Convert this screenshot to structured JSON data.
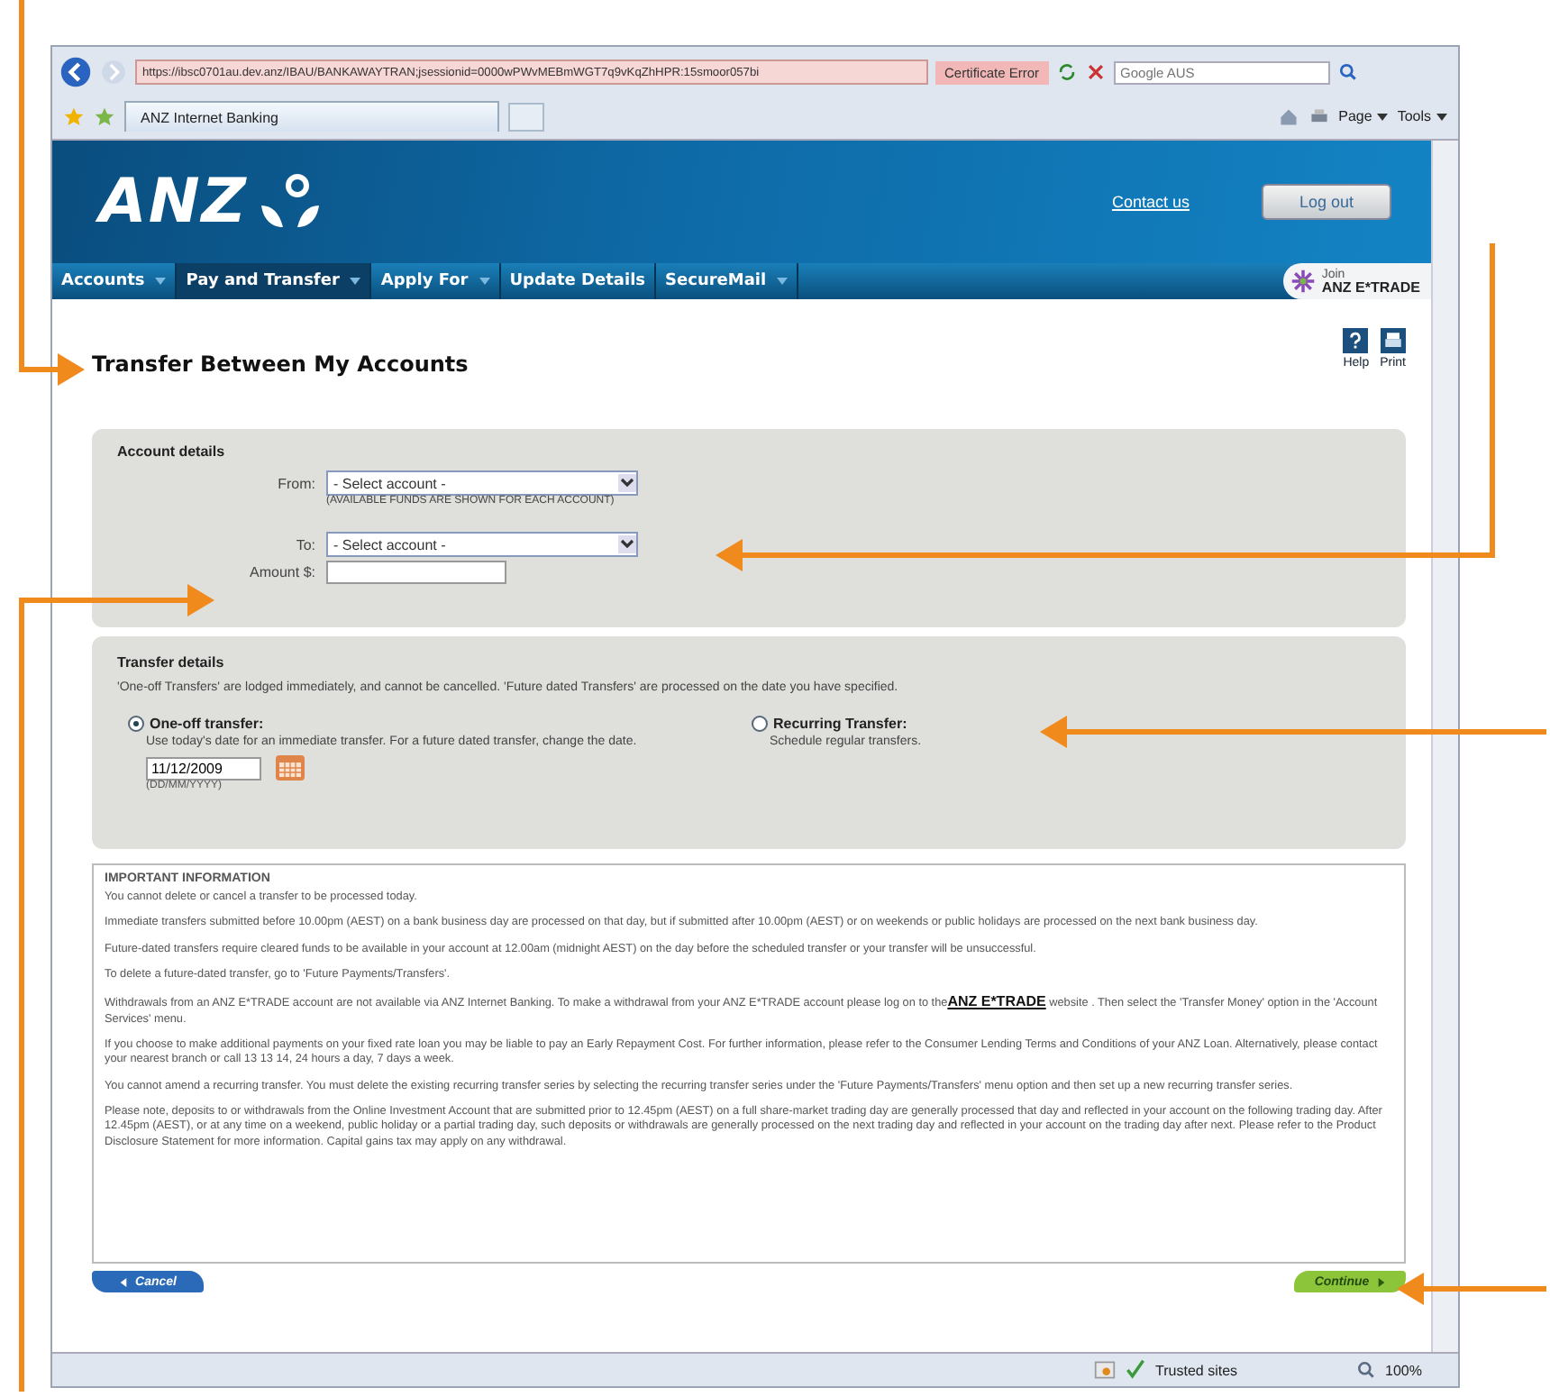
{
  "browser": {
    "url": "https://ibsc0701au.dev.anz/IBAU/BANKAWAYTRAN;jsessionid=0000wPWvMEBmWGT7q9vKqZhHPR:15smoor057bi",
    "cert_error": "Certificate Error",
    "search_placeholder": "Google AUS",
    "tab_title": "ANZ Internet Banking",
    "toolbar": [
      {
        "label": "Page"
      },
      {
        "label": "Tools"
      }
    ]
  },
  "header": {
    "logo": "ANZ",
    "contact": "Contact us",
    "logout": "Log out"
  },
  "nav": [
    {
      "label": "Accounts",
      "dropdown": true,
      "selected": false
    },
    {
      "label": "Pay and Transfer",
      "dropdown": true,
      "selected": true
    },
    {
      "label": "Apply For",
      "dropdown": true,
      "selected": false
    },
    {
      "label": "Update Details",
      "dropdown": false,
      "selected": false
    },
    {
      "label": "SecureMail",
      "dropdown": true,
      "selected": false
    }
  ],
  "promo": {
    "line1": "Join",
    "line2": "ANZ E*TRADE"
  },
  "page_title": "Transfer Between My Accounts",
  "page_actions": [
    {
      "label": "Help",
      "kind": "help"
    },
    {
      "label": "Print",
      "kind": "print"
    }
  ],
  "account_details": {
    "heading": "Account details",
    "from_label": "From:",
    "from_value": "- Select account -",
    "from_hint": "(AVAILABLE FUNDS ARE SHOWN FOR EACH ACCOUNT)",
    "to_label": "To:",
    "to_value": "- Select account -",
    "amount_label": "Amount $:"
  },
  "transfer_details": {
    "heading": "Transfer details",
    "intro": "'One-off Transfers' are lodged immediately, and cannot be cancelled. 'Future dated Transfers' are processed on the date you have specified.",
    "options": [
      {
        "label": "One-off transfer:",
        "description": "Use today's date for an immediate transfer. For a future dated transfer, change the date.",
        "selected": true
      },
      {
        "label": "Recurring Transfer:",
        "description": "Schedule regular transfers.",
        "selected": false
      }
    ],
    "date_value": "11/12/2009",
    "date_hint": "(DD/MM/YYYY)"
  },
  "important": {
    "heading": "IMPORTANT INFORMATION",
    "paragraphs": [
      {
        "text": "You cannot delete or cancel a transfer to be processed today."
      },
      {
        "text": "Immediate transfers submitted before 10.00pm (AEST) on a bank business day are processed on that day, but if submitted after 10.00pm (AEST) or on weekends or public holidays are processed on the next bank business day."
      },
      {
        "text": "Future-dated transfers require cleared funds to be available in your account at 12.00am (midnight AEST) on the day before the scheduled transfer or your transfer will be unsuccessful."
      },
      {
        "text": "To delete a future-dated transfer, go to 'Future Payments/Transfers'."
      },
      {
        "text": "Withdrawals from an ANZ E*TRADE account are not available via ANZ Internet Banking. To make a withdrawal from your ANZ E*TRADE account please log on to the",
        "link": "ANZ E*TRADE",
        "after": "website . Then select the 'Transfer Money' option in the 'Account Services' menu."
      },
      {
        "text": "If you choose to make additional payments on your fixed rate loan you may be liable to pay an Early Repayment Cost. For further information, please refer to the Consumer Lending Terms and Conditions of your ANZ Loan. Alternatively, please contact your nearest branch or call 13 13 14, 24 hours a day, 7 days a week."
      },
      {
        "text": "You cannot amend a recurring transfer. You must delete the existing recurring transfer series by selecting the recurring transfer series under the 'Future Payments/Transfers' menu option and then set up a new recurring transfer series."
      },
      {
        "text": "Please note, deposits to or withdrawals from the Online Investment Account that are submitted prior to 12.45pm (AEST) on a full share-market trading day are generally processed that day and reflected in your account on the following trading day. After 12.45pm (AEST), or at any time on a weekend, public holiday or a partial trading day, such deposits or withdrawals are generally processed on the next trading day and reflected in your account on the trading day after next. Please refer to the Product Disclosure Statement for more information. Capital gains tax may apply on any withdrawal."
      }
    ]
  },
  "buttons": {
    "cancel": "Cancel",
    "continue": "Continue"
  },
  "status_bar": {
    "zone": "Trusted sites",
    "zoom": "100%"
  }
}
